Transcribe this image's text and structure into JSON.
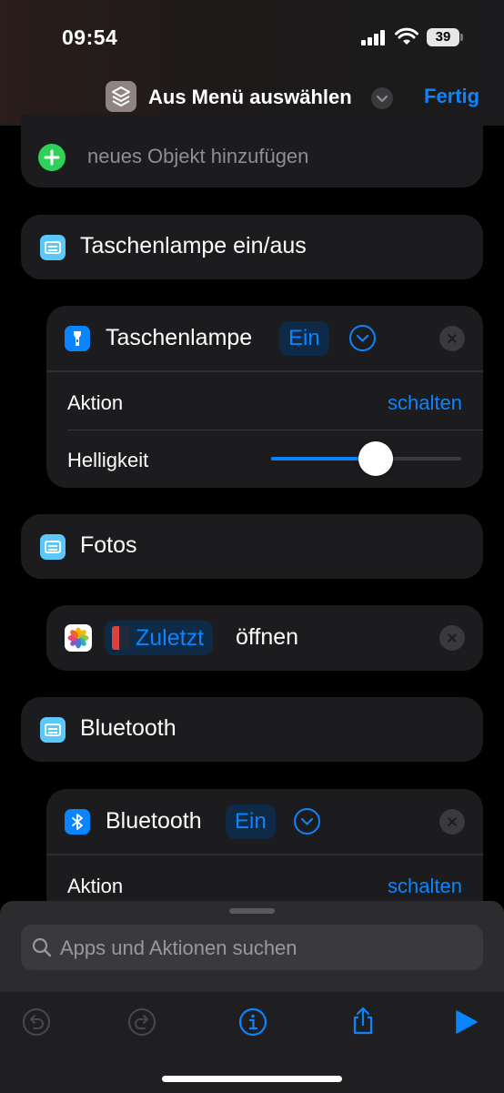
{
  "status": {
    "time": "09:54",
    "battery": "39"
  },
  "nav": {
    "title": "Aus Menü auswählen",
    "done_label": "Fertig"
  },
  "add_item": {
    "label": "neues Objekt hinzufügen"
  },
  "sections": [
    {
      "title": "Taschenlampe ein/aus"
    },
    {
      "title": "Fotos"
    },
    {
      "title": "Bluetooth"
    }
  ],
  "flashlight_action": {
    "title": "Taschenlampe",
    "state": "Ein",
    "rows": [
      {
        "label": "Aktion",
        "value": "schalten"
      },
      {
        "label": "Helligkeit"
      }
    ],
    "brightness": 0.5
  },
  "photos_action": {
    "album": "Zuletzt",
    "verb": "öffnen"
  },
  "bluetooth_action": {
    "title": "Bluetooth",
    "state": "Ein",
    "rows": [
      {
        "label": "Aktion",
        "value": "schalten"
      }
    ]
  },
  "search": {
    "placeholder": "Apps und Aktionen suchen"
  },
  "toolbar": {
    "icons": [
      "undo-icon",
      "redo-icon",
      "info-icon",
      "share-icon",
      "play-icon"
    ]
  },
  "colors": {
    "accent": "#0a84ff",
    "add": "#30d158",
    "variable": "#5ac8fa"
  }
}
